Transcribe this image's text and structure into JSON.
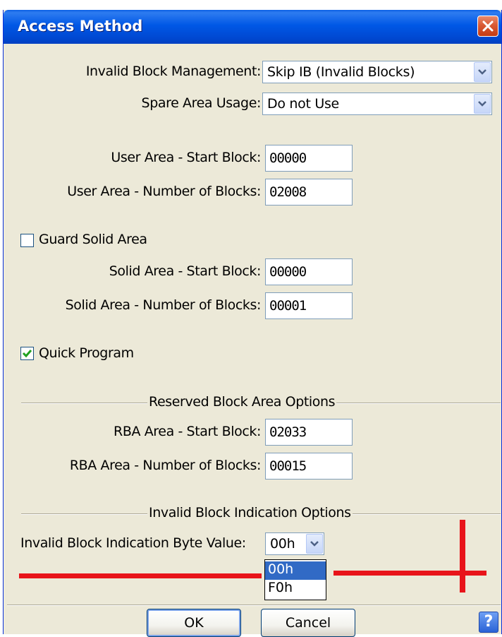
{
  "window": {
    "title": "Access Method"
  },
  "invalid_block_management": {
    "label": "Invalid Block Management:",
    "value": "Skip IB (Invalid Blocks)"
  },
  "spare_area_usage": {
    "label": "Spare Area Usage:",
    "value": "Do not Use"
  },
  "user_area": {
    "start_label": "User Area - Start Block:",
    "start_value": "00000",
    "count_label": "User Area - Number of Blocks:",
    "count_value": "02008"
  },
  "guard_solid_area": {
    "label": "Guard Solid Area",
    "checked": false
  },
  "solid_area": {
    "start_label": "Solid Area - Start Block:",
    "start_value": "00000",
    "count_label": "Solid Area - Number of Blocks:",
    "count_value": "00001"
  },
  "quick_program": {
    "label": "Quick Program",
    "checked": true
  },
  "reserved_block_area": {
    "group_title": "Reserved Block Area Options",
    "start_label": "RBA Area - Start Block:",
    "start_value": "02033",
    "count_label": "RBA Area - Number of Blocks:",
    "count_value": "00015"
  },
  "invalid_block_indication": {
    "group_title": "Invalid Block Indication Options",
    "byte_label": "Invalid Block Indication Byte Value:",
    "byte_value": "00h",
    "options": [
      "00h",
      "F0h"
    ],
    "highlighted_option": "00h"
  },
  "buttons": {
    "ok": "OK",
    "cancel": "Cancel",
    "help": "?"
  },
  "colors": {
    "titlebar": "#0058e6",
    "dialog_bg": "#ece9d8",
    "selection": "#316ac5",
    "annotation_red": "#e8141a"
  }
}
